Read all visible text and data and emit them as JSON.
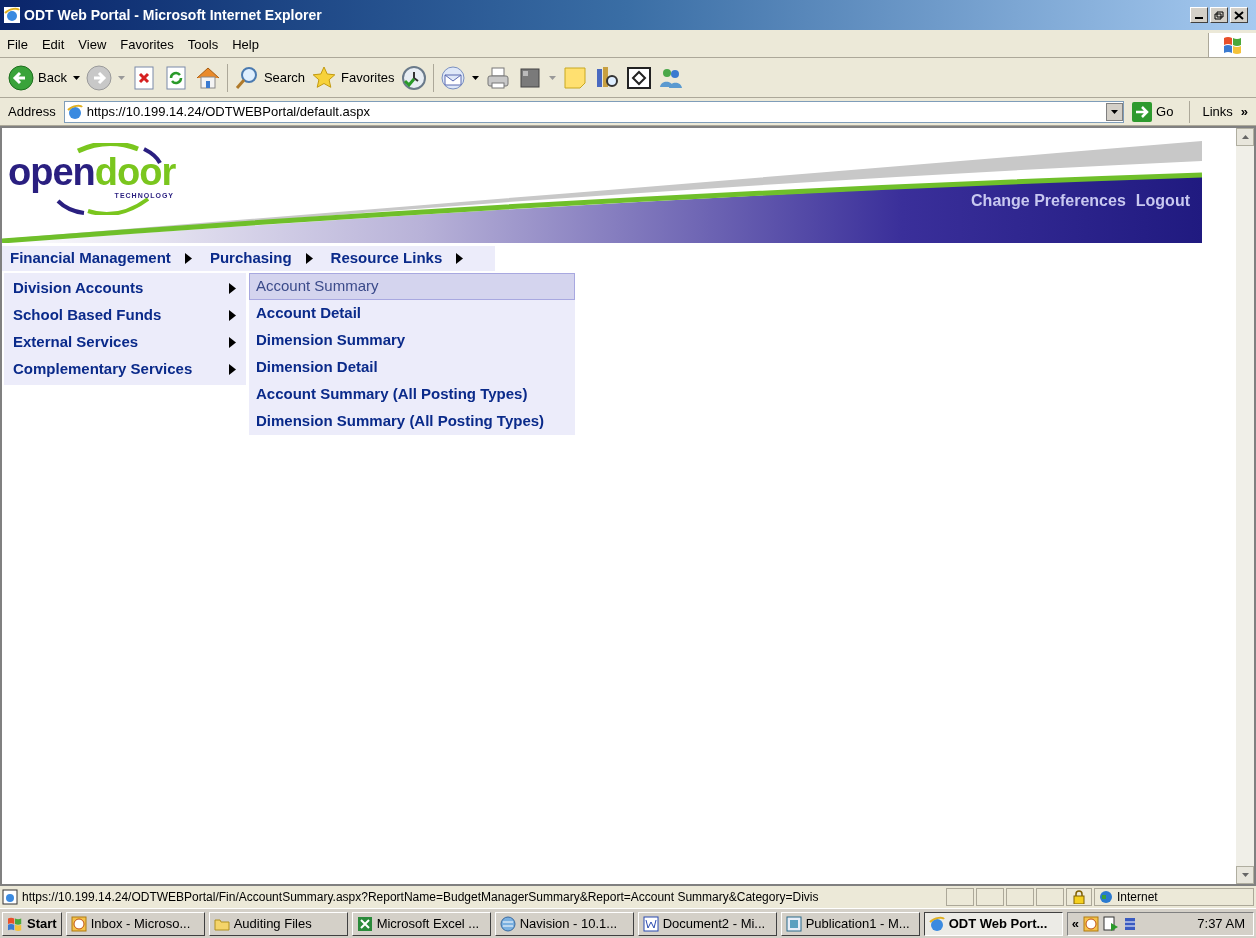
{
  "window": {
    "title": "ODT Web Portal - Microsoft Internet Explorer"
  },
  "menu_bar": [
    "File",
    "Edit",
    "View",
    "Favorites",
    "Tools",
    "Help"
  ],
  "toolbar": [
    {
      "kind": "back",
      "label": "Back"
    },
    {
      "kind": "forward"
    },
    {
      "kind": "stop"
    },
    {
      "kind": "refresh"
    },
    {
      "kind": "home"
    },
    {
      "kind": "search",
      "label": "Search"
    },
    {
      "kind": "favorites",
      "label": "Favorites"
    },
    {
      "kind": "history"
    },
    {
      "kind": "mail"
    },
    {
      "kind": "print"
    },
    {
      "kind": "edit"
    },
    {
      "kind": "note"
    },
    {
      "kind": "research"
    },
    {
      "kind": "window"
    },
    {
      "kind": "messenger"
    }
  ],
  "address_bar": {
    "label": "Address",
    "value": "https://10.199.14.24/ODTWEBPortal/default.aspx",
    "go": "Go",
    "links": "Links",
    "more": "»"
  },
  "page": {
    "logo": {
      "first": "open",
      "second": "door",
      "tagline": "TECHNOLOGY"
    },
    "header_links": [
      "Change Preferences",
      "Logout"
    ],
    "nav_menu": [
      {
        "label": "Financial Management"
      },
      {
        "label": "Purchasing"
      },
      {
        "label": "Resource Links"
      }
    ],
    "submenu": [
      {
        "label": "Division Accounts"
      },
      {
        "label": "School Based Funds"
      },
      {
        "label": "External Services"
      },
      {
        "label": "Complementary Services"
      }
    ],
    "submenu_items": [
      {
        "label": "Account Summary",
        "selected": true
      },
      {
        "label": "Account Detail",
        "selected": false
      },
      {
        "label": "Dimension Summary",
        "selected": false
      },
      {
        "label": "Dimension Detail",
        "selected": false
      },
      {
        "label": "Account Summary (All Posting Types)",
        "selected": false
      },
      {
        "label": "Dimension Summary (All Posting Types)",
        "selected": false
      }
    ]
  },
  "status_bar": {
    "url": "https://10.199.14.24/ODTWEBPortal/Fin/AccountSummary.aspx?ReportName=BudgetManagerSummary&Report=Account Summary&Category=Divis",
    "zone": "Internet"
  },
  "taskbar": {
    "start": "Start",
    "tasks": [
      {
        "kind": "outlook",
        "label": "Inbox - Microso...",
        "selected": false
      },
      {
        "kind": "folder",
        "label": "Auditing Files",
        "selected": false
      },
      {
        "kind": "excel",
        "label": "Microsoft Excel ...",
        "selected": false
      },
      {
        "kind": "navision",
        "label": "Navision - 10.1...",
        "selected": false
      },
      {
        "kind": "word",
        "label": "Document2 - Mi...",
        "selected": false
      },
      {
        "kind": "publisher",
        "label": "Publication1 - M...",
        "selected": false
      },
      {
        "kind": "ie",
        "label": "ODT Web Port...",
        "selected": true
      }
    ],
    "tray_toggle": "«",
    "clock": "7:37 AM"
  }
}
